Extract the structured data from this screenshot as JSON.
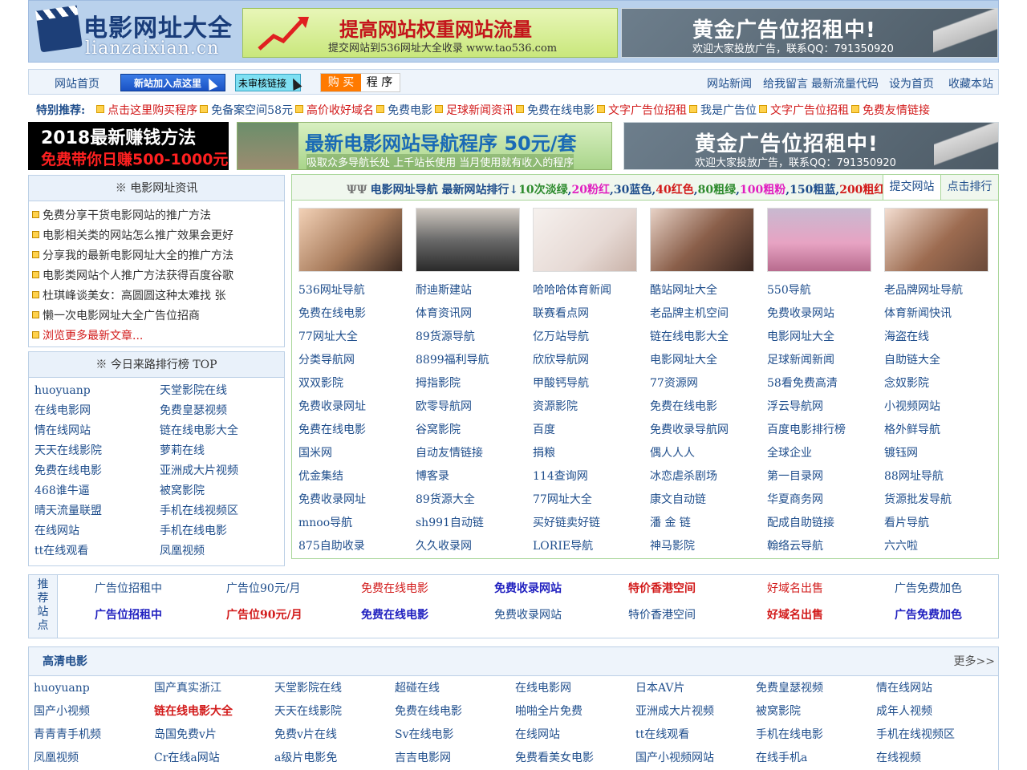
{
  "header": {
    "logo_cn": "电影网址大全",
    "logo_en": "lianzaixian.cn",
    "banner_weight": {
      "title": "提高网站权重网站流量",
      "sub": "提交网站到536网址大全收录 www.tao536.com"
    },
    "banner_gold": {
      "title": "黄金广告位招租中!",
      "sub": "欢迎大家投放广告，联系QQ：791350920"
    }
  },
  "nav": {
    "home": "网站首页",
    "new_site": "新站加入点这里",
    "unreviewed": "未审核链接",
    "buy": "购 买",
    "program": "程 序",
    "right": [
      "网站新闻",
      "给我留言",
      "最新流量代码",
      "设为首页",
      "收藏本站"
    ]
  },
  "special": {
    "label": "特别推荐:",
    "items": [
      {
        "text": "点击这里购买程序",
        "color": "#d21a1a"
      },
      {
        "text": "免备案空间58元",
        "color": "#1f4e8c"
      },
      {
        "text": "高价收好域名",
        "color": "#d21a1a"
      },
      {
        "text": "免费电影",
        "color": "#1f4e8c"
      },
      {
        "text": "足球新闻资讯",
        "color": "#d21a1a"
      },
      {
        "text": "免费在线电影",
        "color": "#1f4e8c"
      },
      {
        "text": "文字广告位招租",
        "color": "#d21a1a"
      },
      {
        "text": "我是广告位",
        "color": "#1f4e8c"
      },
      {
        "text": "文字广告位招租",
        "color": "#d21a1a"
      },
      {
        "text": "免费友情链接",
        "color": "#d21a1a"
      }
    ]
  },
  "banners2": {
    "earn": {
      "title": "2018最新赚钱方法",
      "sub": "免费带你日赚500-1000元"
    },
    "program": {
      "title": "最新电影网站导航程序 50元/套",
      "sub": "吸取众多导航长处 上千站长使用 当月使用就有收入的程序"
    },
    "gold": {
      "title": "黄金广告位招租中!",
      "sub": "欢迎大家投放广告，联系QQ：791350920"
    }
  },
  "news": {
    "title": "※ 电影网址资讯",
    "items": [
      "免费分享干货电影网站的推广方法",
      "电影相关类的网站怎么推广效果会更好",
      "分享我的最新电影网址大全的推广方法",
      "电影类网站个人推广方法获得百度谷歌",
      "杜琪峰谈美女：高圆圆这种太难找 张",
      "懒一次电影网址大全广告位招商"
    ],
    "more": "浏览更多最新文章..."
  },
  "rank": {
    "title": "※ 今日来路排行榜 TOP",
    "items": [
      "huoyuanp",
      "天堂影院在线",
      "在线电影网",
      "免费皇瑟视频",
      "情在线网站",
      "链在线电影大全",
      "天天在线影院",
      "萝莉在线",
      "免费在线电影",
      "亚洲成大片视频",
      "468谁牛逼",
      "被窝影院",
      "晴天流量联盟",
      "手机在线视频区",
      "在线网站",
      "手机在线电影",
      "tt在线观看",
      "凤凰视频"
    ]
  },
  "main": {
    "title_prefix": "电影网址导航 最新网站排行↓",
    "levels": [
      {
        "text": "10次淡绿",
        "color": "#2e8b2e"
      },
      {
        "text": "20粉红",
        "color": "#e020c0"
      },
      {
        "text": "30蓝色",
        "color": "#1f4e8c"
      },
      {
        "text": "40红色",
        "color": "#d21a1a"
      },
      {
        "text": "80粗绿",
        "color": "#2e8b2e"
      },
      {
        "text": "100粗粉",
        "color": "#e020c0"
      },
      {
        "text": "150粗蓝",
        "color": "#1f4e8c"
      },
      {
        "text": "200粗红",
        "color": "#d21a1a"
      }
    ],
    "tab_submit": "提交网站",
    "tab_click": "点击排行",
    "links": [
      "536网址导航",
      "耐迪斯建站",
      "哈哈哈体育新闻",
      "酷站网址大全",
      "550导航",
      "老品牌网址导航",
      "免费在线电影",
      "体育资讯网",
      "联赛看点网",
      "老品牌主机空间",
      "免费收录网站",
      "体育新闻快讯",
      "77网址大全",
      "89货源导航",
      "亿万站导航",
      "链在线电影大全",
      "电影网址大全",
      "海盗在线",
      "分类导航网",
      "8899福利导航",
      "欣欣导航网",
      "电影网址大全",
      "足球新闻新闻",
      "自助链大全",
      "双双影院",
      "拇指影院",
      "甲酸钙导航",
      "77资源网",
      "58看免费高清",
      "念奴影院",
      "免费收录网址",
      "欧零导航网",
      "资源影院",
      "免费在线电影",
      "浮云导航网",
      "小视频网站",
      "免费在线电影",
      "谷窝影院",
      "百度",
      "免费收录导航网",
      "百度电影排行榜",
      "格外鲜导航",
      "国米网",
      "自动友情链接",
      "捐粮",
      "偶人人人",
      "全球企业",
      "镀钰网",
      "优金集结",
      "博客录",
      "114查询网",
      "冰恋虐杀剧场",
      "第一目录网",
      "88网址导航",
      "免费收录网址",
      "89货源大全",
      "77网址大全",
      "康文自动链",
      "华夏商务网",
      "货源批发导航",
      "mnoo导航",
      "sh991自动链",
      "买好链卖好链",
      "潘 金 链",
      "配成自助链接",
      "看片导航",
      "875自助收录",
      "久久收录网",
      "LORIE导航",
      "神马影院",
      "翰络云导航",
      "六六啦"
    ]
  },
  "rec": {
    "side": "推荐站点",
    "items": [
      {
        "text": "广告位招租中",
        "color": "#1f4e8c",
        "bold": false
      },
      {
        "text": "广告位90元/月",
        "color": "#1f4e8c",
        "bold": false
      },
      {
        "text": "免费在线电影",
        "color": "#d21a1a",
        "bold": false
      },
      {
        "text": "免费收录网站",
        "color": "#1f1fbf",
        "bold": true
      },
      {
        "text": "特价香港空间",
        "color": "#d21a1a",
        "bold": true
      },
      {
        "text": "好域名出售",
        "color": "#d21a1a",
        "bold": false
      },
      {
        "text": "广告免费加色",
        "color": "#1f4e8c",
        "bold": false
      },
      {
        "text": "广告位招租中",
        "color": "#1f1fbf",
        "bold": true
      },
      {
        "text": "广告位90元/月",
        "color": "#d21a1a",
        "bold": true
      },
      {
        "text": "免费在线电影",
        "color": "#1f1fbf",
        "bold": true
      },
      {
        "text": "免费收录网站",
        "color": "#1f4e8c",
        "bold": false
      },
      {
        "text": "特价香港空间",
        "color": "#1f4e8c",
        "bold": false
      },
      {
        "text": "好域名出售",
        "color": "#d21a1a",
        "bold": true
      },
      {
        "text": "广告免费加色",
        "color": "#1f1fbf",
        "bold": true
      }
    ]
  },
  "hd": {
    "title": "高清电影",
    "more": "更多>>",
    "items": [
      "huoyuanp",
      "国产真实浙江",
      "天堂影院在线",
      "超碰在线",
      "在线电影网",
      "日本AV片",
      "免费皇瑟视频",
      "情在线网站",
      "国产小视频",
      "链在线电影大全",
      "天天在线影院",
      "免费在线电影",
      "啪啪全片免费",
      "亚洲成大片视频",
      "被窝影院",
      "成年人视频",
      "青青青手机频",
      "岛国免费v片",
      "免费v片在线",
      "Sv在线电影",
      "在线网站",
      "tt在线观看",
      "手机在线电影",
      "手机在线视频区",
      "凤凰视频",
      "Cr在线a网站",
      "a级片电影免",
      "吉吉电影网",
      "免费看美女电影",
      "国产小视频网站",
      "在线手机a",
      "在线视频"
    ],
    "highlight_index": 9
  },
  "colors": {
    "accent": "#1f4e8c",
    "red": "#d21a1a",
    "green_border": "#a9d69a"
  }
}
